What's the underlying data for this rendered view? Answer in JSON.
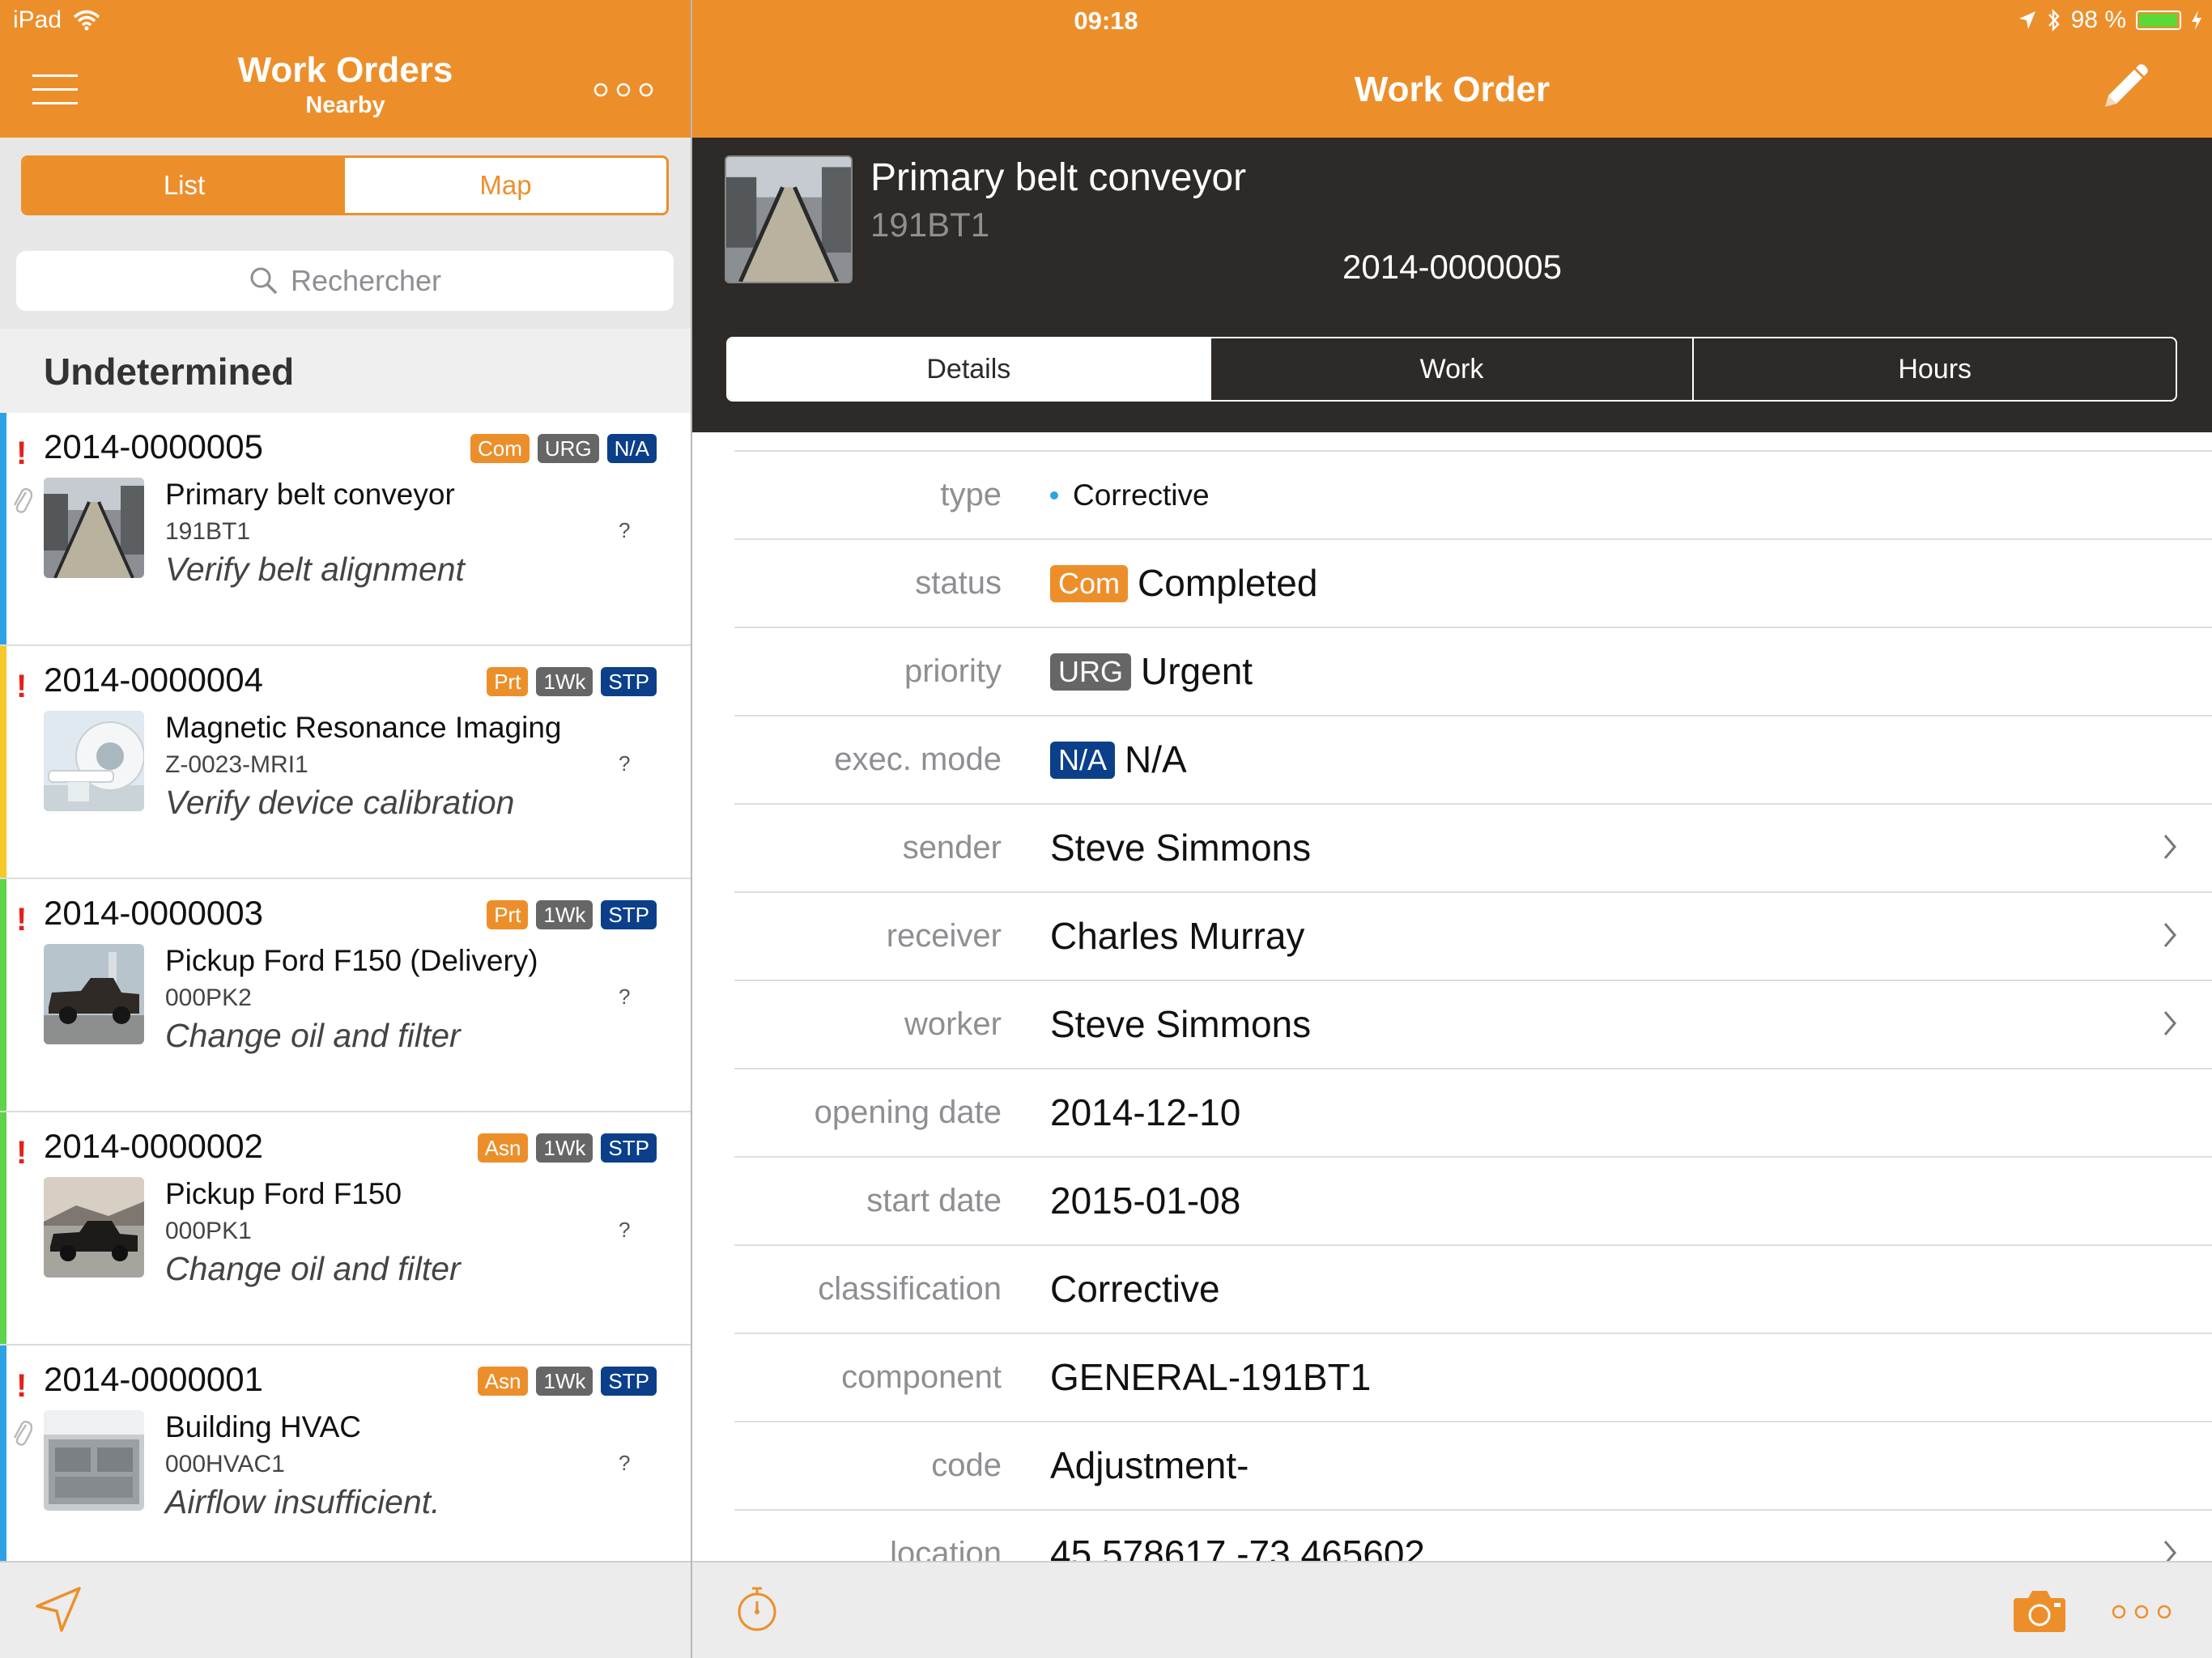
{
  "status_bar": {
    "device": "iPad",
    "time": "09:18",
    "battery_text": "98 %",
    "battery_level": 0.98
  },
  "left_panel": {
    "title": "Work Orders",
    "subtitle": "Nearby",
    "segments": [
      "List",
      "Map"
    ],
    "active_segment": "List",
    "search_placeholder": "Rechercher",
    "section_header": "Undetermined",
    "items": [
      {
        "id": "2014-0000005",
        "badges": [
          {
            "text": "Com",
            "color": "#ec8f2b"
          },
          {
            "text": "URG",
            "color": "#666666"
          },
          {
            "text": "N/A",
            "color": "#0b3f8a"
          }
        ],
        "name": "Primary belt conveyor",
        "code": "191BT1",
        "desc": "Verify belt alignment",
        "q": "?",
        "stripe": "#2ea2e5",
        "attachment": true,
        "thumb": "conveyor"
      },
      {
        "id": "2014-0000004",
        "badges": [
          {
            "text": "Prt",
            "color": "#ec8f2b"
          },
          {
            "text": "1Wk",
            "color": "#666666"
          },
          {
            "text": "STP",
            "color": "#0b3f8a"
          }
        ],
        "name": "Magnetic Resonance Imaging",
        "code": "Z-0023-MRI1",
        "desc": "Verify device calibration",
        "q": "?",
        "stripe": "#f6c829",
        "attachment": false,
        "thumb": "mri"
      },
      {
        "id": "2014-0000003",
        "badges": [
          {
            "text": "Prt",
            "color": "#ec8f2b"
          },
          {
            "text": "1Wk",
            "color": "#666666"
          },
          {
            "text": "STP",
            "color": "#0b3f8a"
          }
        ],
        "name": "Pickup Ford F150 (Delivery)",
        "code": "000PK2",
        "desc": "Change oil and filter",
        "q": "?",
        "stripe": "#5fd34a",
        "attachment": false,
        "thumb": "truck1"
      },
      {
        "id": "2014-0000002",
        "badges": [
          {
            "text": "Asn",
            "color": "#ec8f2b"
          },
          {
            "text": "1Wk",
            "color": "#666666"
          },
          {
            "text": "STP",
            "color": "#0b3f8a"
          }
        ],
        "name": "Pickup Ford F150",
        "code": "000PK1",
        "desc": "Change oil and filter",
        "q": "?",
        "stripe": "#5fd34a",
        "attachment": false,
        "thumb": "truck2"
      },
      {
        "id": "2014-0000001",
        "badges": [
          {
            "text": "Asn",
            "color": "#ec8f2b"
          },
          {
            "text": "1Wk",
            "color": "#666666"
          },
          {
            "text": "STP",
            "color": "#0b3f8a"
          }
        ],
        "name": "Building HVAC",
        "code": "000HVAC1",
        "desc": "Airflow insufficient.",
        "q": "?",
        "stripe": "#2ea2e5",
        "attachment": true,
        "thumb": "hvac"
      }
    ]
  },
  "right_panel": {
    "title": "Work Order",
    "header": {
      "name": "Primary belt conveyor",
      "code": "191BT1",
      "id": "2014-0000005"
    },
    "tabs": [
      "Details",
      "Work",
      "Hours"
    ],
    "active_tab": "Details",
    "details": [
      {
        "label": "type",
        "value": "Corrective",
        "dot": true
      },
      {
        "label": "status",
        "badge": "Com",
        "badge_color": "#ec8f2b",
        "value": "Completed"
      },
      {
        "label": "priority",
        "badge": "URG",
        "badge_color": "#666666",
        "value": "Urgent"
      },
      {
        "label": "exec. mode",
        "badge": "N/A",
        "badge_color": "#0b3f8a",
        "value": "N/A"
      },
      {
        "label": "sender",
        "value": "Steve Simmons",
        "chevron": true
      },
      {
        "label": "receiver",
        "value": "Charles Murray",
        "chevron": true
      },
      {
        "label": "worker",
        "value": "Steve Simmons",
        "chevron": true
      },
      {
        "label": "opening date",
        "value": "2014-12-10"
      },
      {
        "label": "start date",
        "value": "2015-01-08"
      },
      {
        "label": "classification",
        "value": "Corrective"
      },
      {
        "label": "component",
        "value": "GENERAL-191BT1"
      },
      {
        "label": "code",
        "value": "Adjustment-"
      },
      {
        "label": "location",
        "value": "45,578617,-73,465602",
        "chevron": true
      }
    ]
  },
  "colors": {
    "accent": "#ec8f2b",
    "dark_header": "#2d2a27",
    "blue_badge": "#0b3f8a",
    "grey_badge": "#666666"
  },
  "icons": [
    "wifi-icon",
    "location-arrow-icon",
    "bluetooth-icon",
    "battery-icon",
    "menu-icon",
    "more-icon",
    "search-icon",
    "paperclip-icon",
    "pencil-icon",
    "navigate-icon",
    "timer-icon",
    "camera-icon",
    "chevron-right-icon"
  ]
}
